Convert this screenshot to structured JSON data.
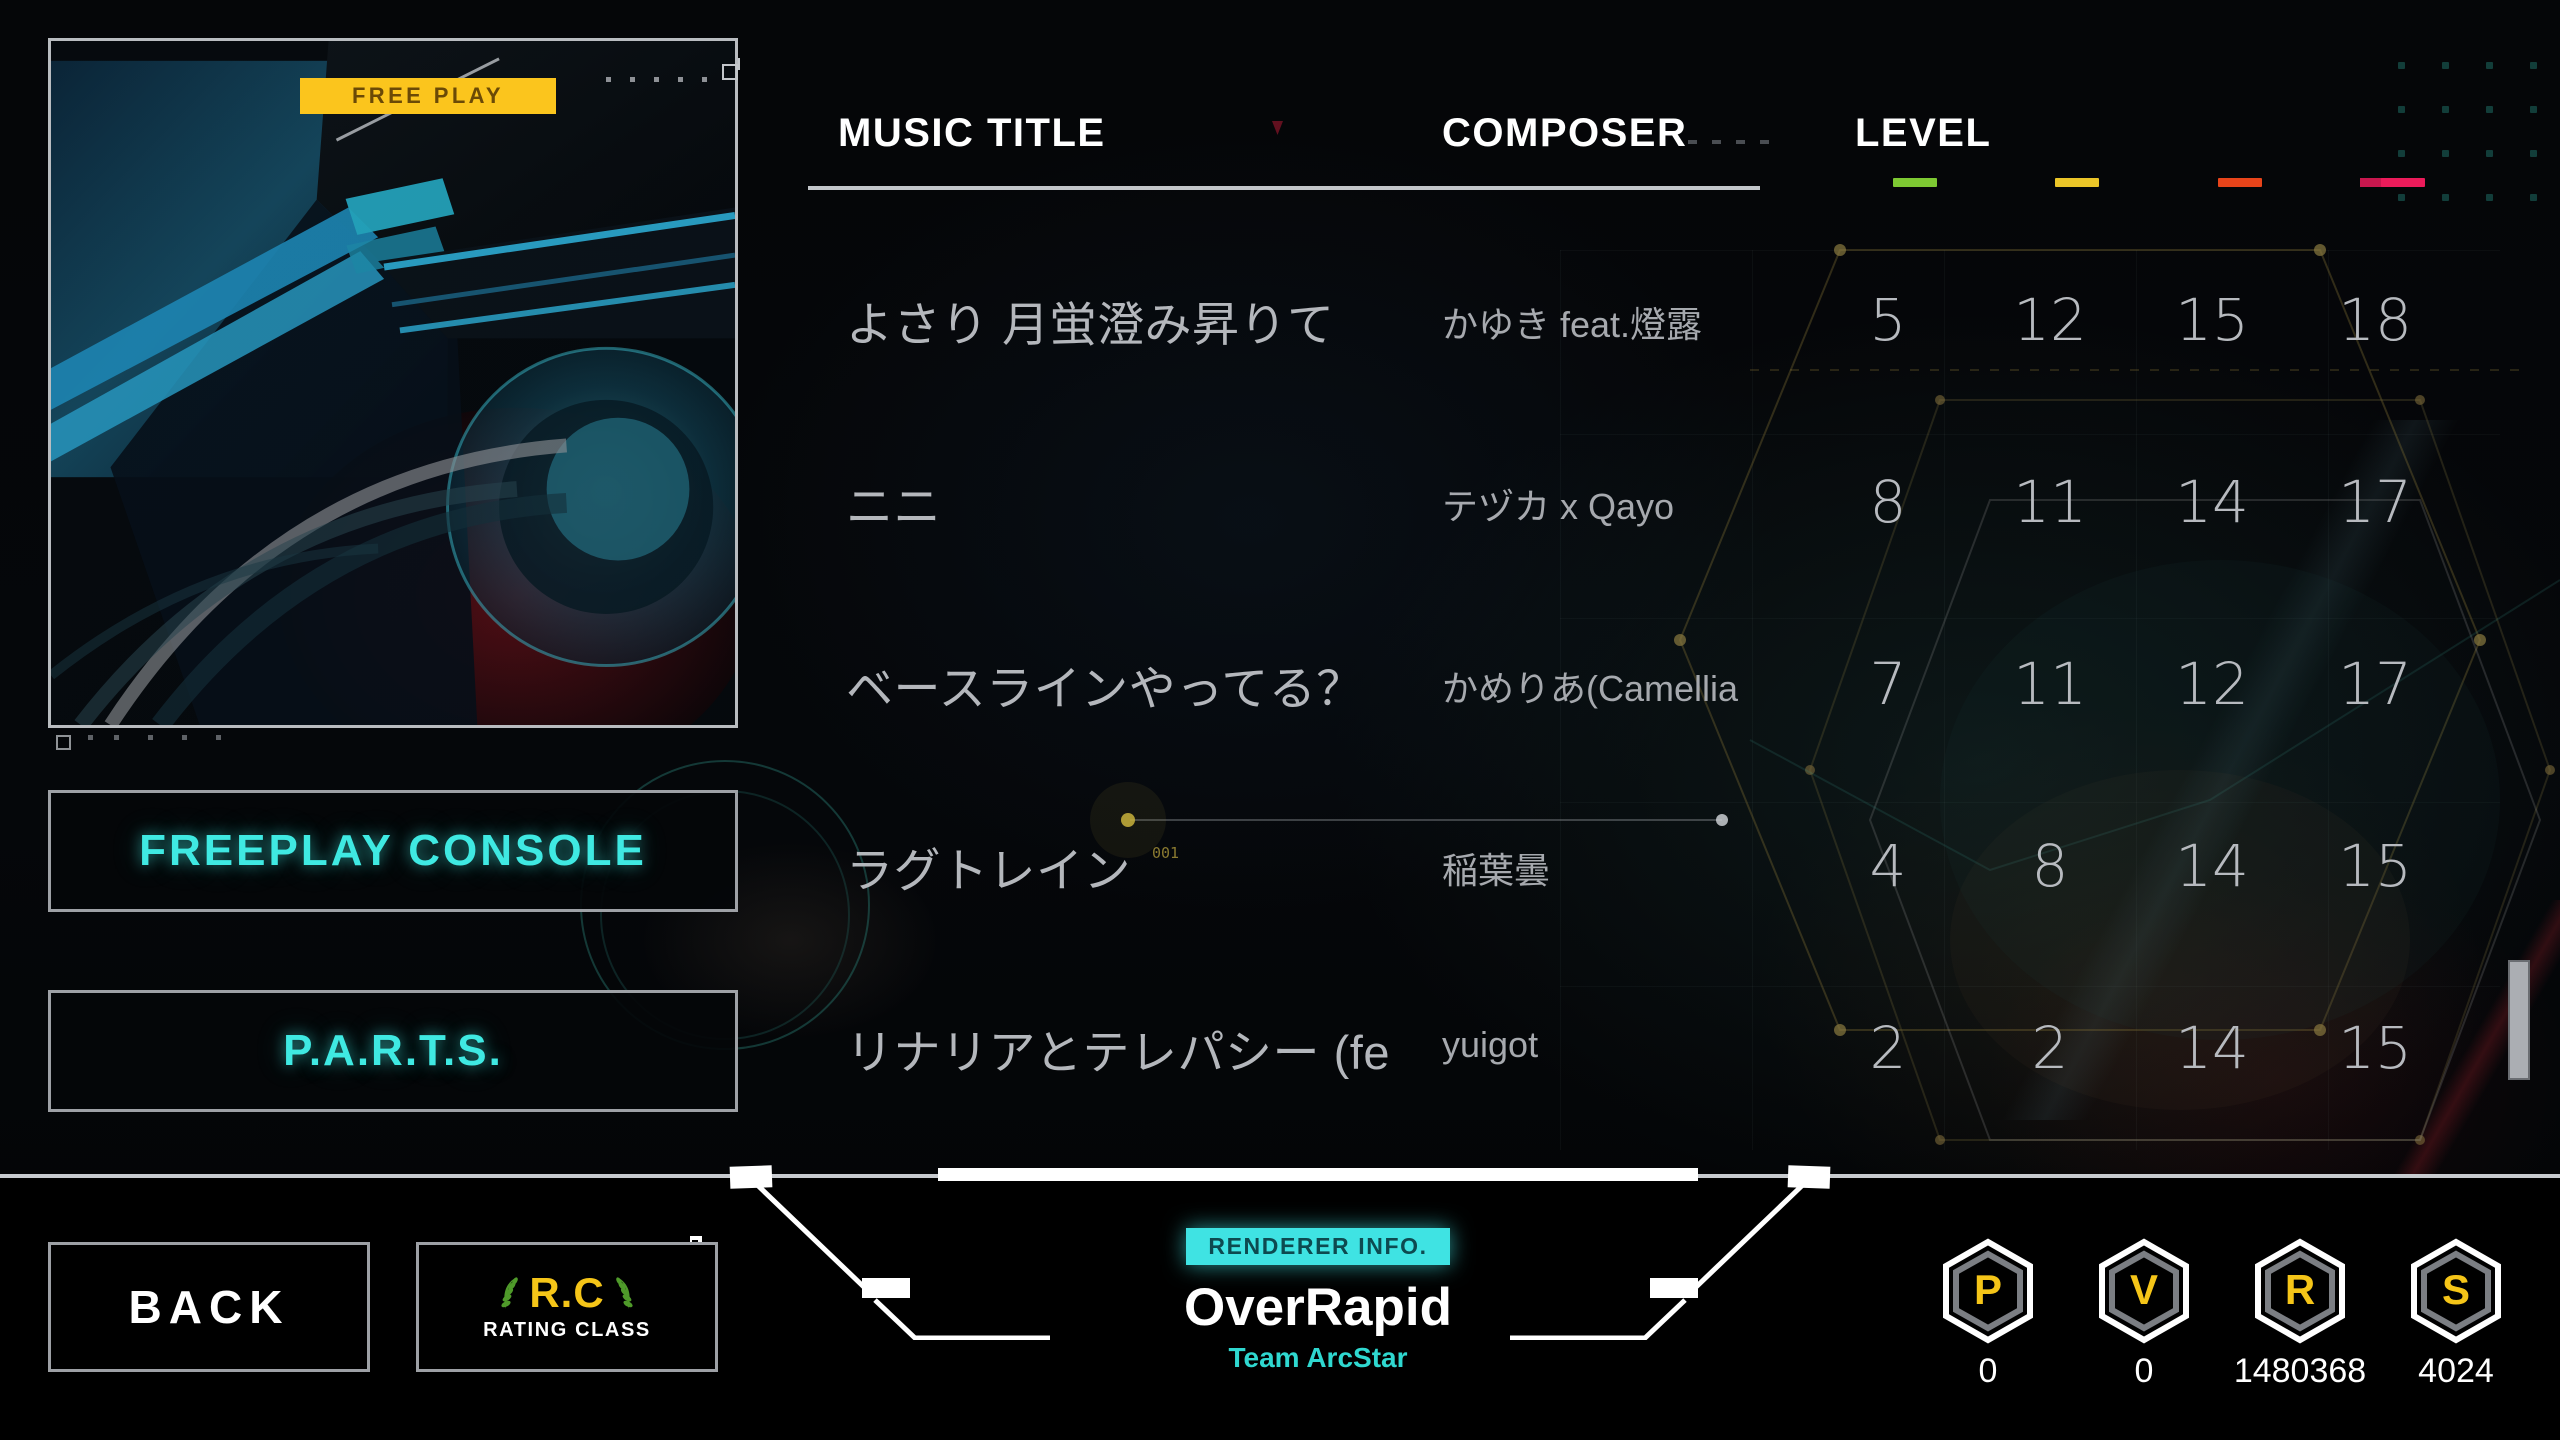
{
  "jacket": {
    "badge_label": "FREE PLAY",
    "badge_color": "#FBC51D",
    "badge_text_color": "#6B4A06"
  },
  "sidebar": {
    "buttons": [
      {
        "label": "FREEPLAY CONSOLE",
        "name": "freeplay-console"
      },
      {
        "label": "P.A.R.T.S.",
        "name": "parts"
      }
    ],
    "accent_color": "#3FE9E2"
  },
  "list": {
    "headers": {
      "title": "MUSIC TITLE",
      "composer": "COMPOSER",
      "level": "LEVEL"
    },
    "difficulty_colors": [
      "#7DC832",
      "#EBC528",
      "#E8441A",
      "#EC1B5A"
    ],
    "rows": [
      {
        "title": "よさり 月蛍澄み昇りて",
        "composer": "かゆき feat.燈露",
        "levels": [
          "5",
          "12",
          "15",
          "18"
        ]
      },
      {
        "title": "ニニ",
        "composer": "テヅカ x Qayo",
        "levels": [
          "8",
          "11",
          "14",
          "17"
        ]
      },
      {
        "title": "ベースラインやってる？",
        "composer": "かめりあ(Camellia",
        "levels": [
          "7",
          "11",
          "12",
          "17"
        ]
      },
      {
        "title": "ラグトレイン",
        "composer": "稲葉曇",
        "levels": [
          "4",
          "8",
          "14",
          "15"
        ]
      },
      {
        "title": "リナリアとテレパシー (fe",
        "composer": "yuigot",
        "levels": [
          "2",
          "2",
          "14",
          "15"
        ]
      }
    ]
  },
  "footer": {
    "back_label": "BACK",
    "rating_class": {
      "initials": "R.C",
      "caption": "RATING CLASS",
      "initials_color": "#F5C518"
    },
    "renderer": {
      "badge": "RENDERER INFO.",
      "name": "OverRapid",
      "team": "Team ArcStar",
      "badge_color": "#3FE3E3",
      "team_color": "#2FD8D0"
    },
    "stats": [
      {
        "letter": "P",
        "value": "0"
      },
      {
        "letter": "V",
        "value": "0"
      },
      {
        "letter": "R",
        "value": "1480368"
      },
      {
        "letter": "S",
        "value": "4024"
      }
    ]
  }
}
